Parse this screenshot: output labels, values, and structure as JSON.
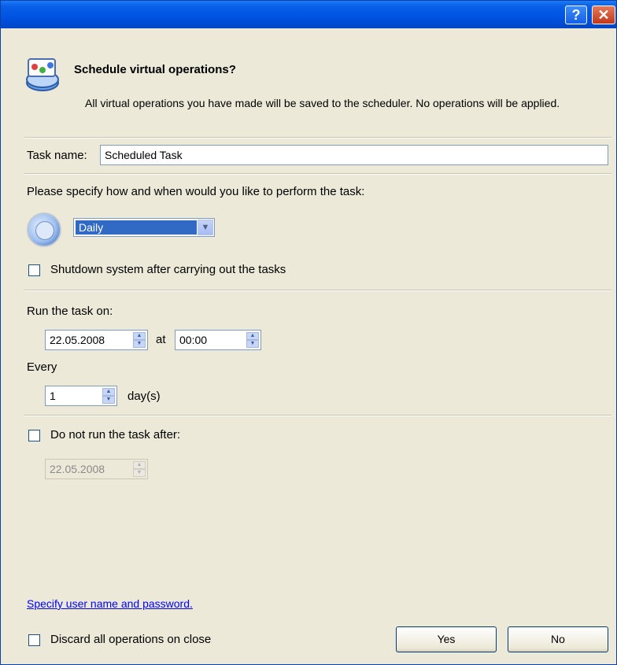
{
  "window": {
    "help_glyph": "?",
    "close_glyph": "✕"
  },
  "header": {
    "title": "Schedule virtual operations?",
    "description": "All virtual operations you have made will be saved to the scheduler. No operations will be applied."
  },
  "task_name": {
    "label": "Task name:",
    "value": "Scheduled Task"
  },
  "schedule": {
    "prompt": "Please specify how and when would you like to perform the task:",
    "frequency_selected": "Daily",
    "shutdown_label": "Shutdown system after carrying out the tasks",
    "shutdown_checked": false
  },
  "run": {
    "label": "Run the task on:",
    "date": "22.05.2008",
    "at_label": "at",
    "time": "00:00",
    "every_label": "Every",
    "every_value": "1",
    "unit_label": "day(s)"
  },
  "end": {
    "label": "Do not run the task after:",
    "checked": false,
    "date": "22.05.2008"
  },
  "footer": {
    "link": "Specify user name and password.",
    "discard_label": "Discard all operations on close",
    "discard_checked": false,
    "yes_label": "Yes",
    "no_label": "No"
  },
  "colors": {
    "titlebar": "#0054e3",
    "dialog_bg": "#ece9d8",
    "selection": "#316ac5",
    "link": "#0000ff"
  }
}
